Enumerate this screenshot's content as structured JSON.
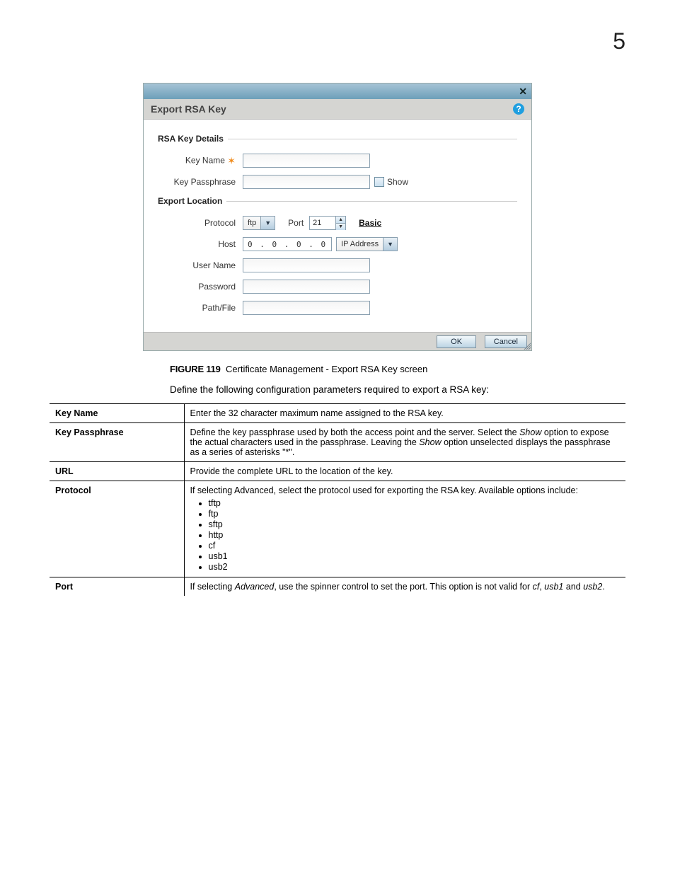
{
  "page": {
    "number": "5"
  },
  "dialog": {
    "close_glyph": "✕",
    "title": "Export RSA Key",
    "help_glyph": "?",
    "section_rsa": "RSA Key Details",
    "section_export": "Export Location",
    "labels": {
      "key_name": "Key Name",
      "key_passphrase": "Key Passphrase",
      "show": "Show",
      "protocol": "Protocol",
      "port": "Port",
      "host": "Host",
      "user_name": "User Name",
      "password": "Password",
      "path_file": "Path/File"
    },
    "values": {
      "protocol": "ftp",
      "port": "21",
      "host_ip": "0 . 0 . 0 . 0",
      "host_type": "IP Address"
    },
    "link_basic": "Basic",
    "buttons": {
      "ok": "OK",
      "cancel": "Cancel"
    }
  },
  "caption": {
    "figure_label": "FIGURE 119",
    "figure_text": "Certificate Management - Export RSA Key screen"
  },
  "intro": "Define the following configuration parameters required to export a RSA key:",
  "params": {
    "rows": [
      {
        "name": "Key Name",
        "desc_plain": "Enter the 32 character maximum name assigned to the RSA key."
      },
      {
        "name": "Key Passphrase",
        "desc_pre": "Define the key passphrase used by both the access point and the server. Select the ",
        "desc_em1": "Show",
        "desc_mid": " option to expose the actual characters used in the passphrase. Leaving the ",
        "desc_em2": "Show",
        "desc_post": " option unselected displays the passphrase as a series of asterisks \"*\"."
      },
      {
        "name": "URL",
        "desc_plain": "Provide the complete URL to the location of the key."
      },
      {
        "name": "Protocol",
        "desc_plain": "If selecting Advanced, select the protocol used for exporting the RSA key. Available options include:",
        "list": [
          "tftp",
          "ftp",
          "sftp",
          "http",
          "cf",
          "usb1",
          "usb2"
        ]
      },
      {
        "name": "Port",
        "desc_pre": "If selecting ",
        "desc_em1": "Advanced",
        "desc_mid": ", use the spinner control to set the port. This option is not valid for ",
        "desc_em2": "cf",
        "desc_mid2": ", ",
        "desc_em3": "usb1",
        "desc_mid3": " and ",
        "desc_em4": "usb2",
        "desc_post": "."
      }
    ]
  }
}
